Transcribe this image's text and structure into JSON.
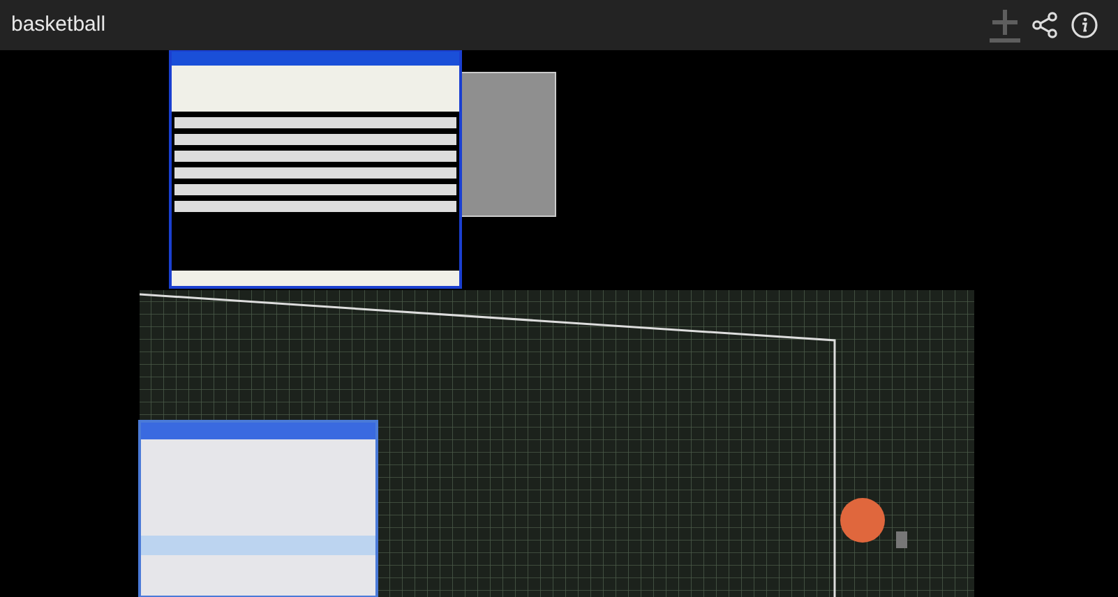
{
  "player": {
    "title": "basketball"
  }
}
